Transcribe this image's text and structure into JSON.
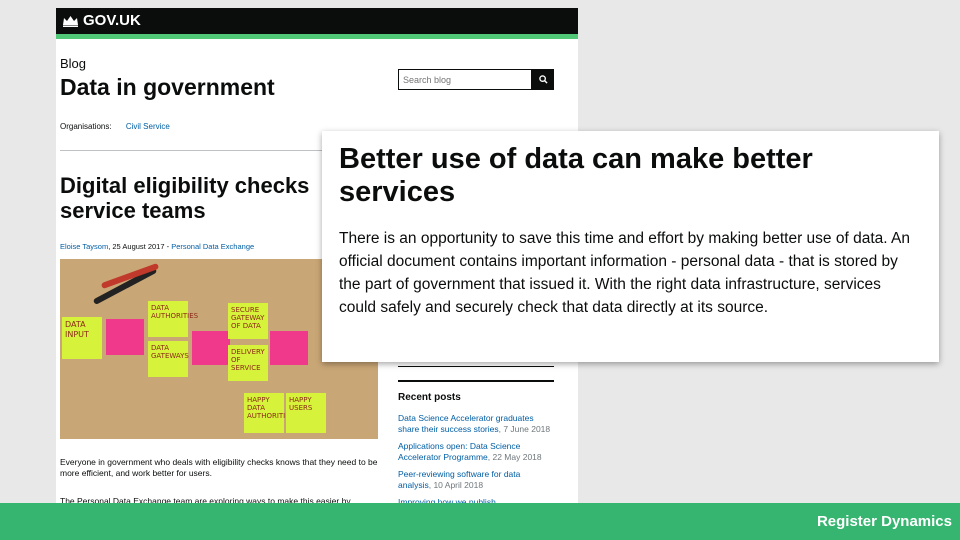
{
  "header": {
    "logo_text": "GOV.UK",
    "logo_icon": "crown-icon"
  },
  "blog": {
    "section_label": "Blog",
    "title": "Data in government"
  },
  "search": {
    "placeholder": "Search blog",
    "icon": "search-icon"
  },
  "organisations": {
    "label": "Organisations:",
    "value": "Civil Service"
  },
  "post": {
    "title": "Digital eligibility checks service teams",
    "author": "Eloise Taysom",
    "date": ", 25 August 2017 - ",
    "category": "Personal Data Exchange",
    "paragraph1": "Everyone in government who deals with eligibility checks knows that they need to be more efficient, and work better for users.",
    "paragraph2": "The Personal Data Exchange team are exploring ways to make this easier by prototyping a simple and secure way to digitally check eligibility using personal data held by government. We'll discuss how we're doing this work in this blog post."
  },
  "photo_notes": {
    "n1": "DATA INPUT",
    "n2": "DATA AUTHORITIES",
    "n3": "DATA GATEWAYS",
    "n4": "SECURE GATEWAY OF DATA",
    "n5": "DELIVERY OF SERVICE",
    "n6": "HAPPY DATA AUTHORITIES",
    "n7": "HAPPY USERS"
  },
  "recent": {
    "title": "Recent posts",
    "items": [
      {
        "title": "Data Science Accelerator graduates share their success stories",
        "date": ", 7 June 2018"
      },
      {
        "title": "Applications open: Data Science Accelerator Programme",
        "date": ", 22 May 2018"
      },
      {
        "title": "Peer-reviewing software for data analysis",
        "date": ", 10 April 2018"
      },
      {
        "title": "Improving how we publish",
        "date": ""
      }
    ]
  },
  "callout": {
    "title": "Better use of data can make better services",
    "body": "There is an opportunity to save this time and effort by making better use of data. An official document contains important information - personal data - that is stored by the part of government that issued it. With the right data infrastructure, services could safely and securely check that data directly at its source."
  },
  "footer": {
    "brand": "Register Dynamics"
  },
  "colors": {
    "gov_black": "#0b0c0c",
    "link_blue": "#005ea5",
    "footer_green": "#35b56f",
    "note_green": "#d7f23b",
    "note_pink": "#f0398a"
  }
}
